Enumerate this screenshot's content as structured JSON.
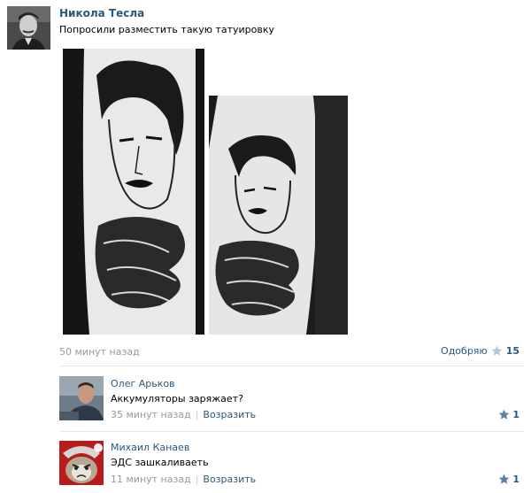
{
  "post": {
    "author": "Никола Тесла",
    "text": "Попросили разместить такую татуировку",
    "time": "50 минут назад",
    "like_label": "Одобряю",
    "like_count": "15"
  },
  "comments": [
    {
      "author": "Олег Арьков",
      "text": "Аккумуляторы заряжает?",
      "time": "35 минут назад",
      "reply": "Возразить",
      "likes": "1"
    },
    {
      "author": "Михаил Канаев",
      "text": "ЭДС зашкаливаеть",
      "time": "11 минут назад",
      "reply": "Возразить",
      "likes": "1"
    }
  ],
  "colors": {
    "link": "#2b587a",
    "muted": "#999999",
    "divider": "#e7eaed",
    "star": "#5a7fa5"
  }
}
